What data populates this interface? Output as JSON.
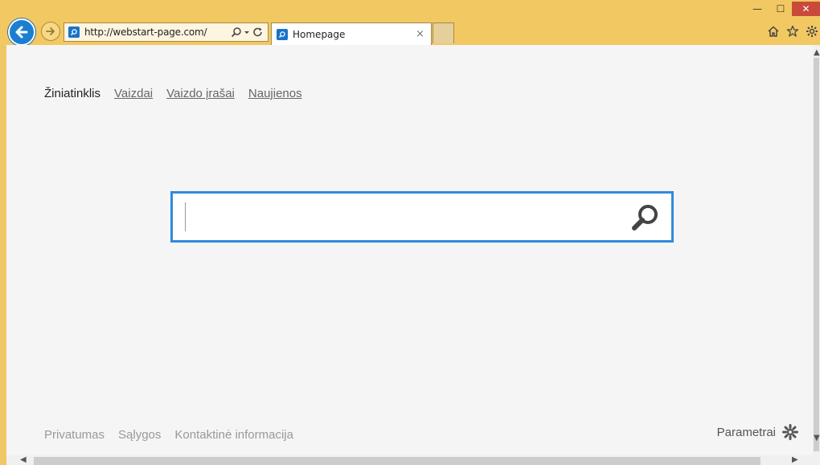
{
  "browser": {
    "url": "http://webstart-page.com/",
    "tab_title": "Homepage",
    "tab_close": "×",
    "window_controls": {
      "minimize": "—",
      "maximize": "☐",
      "close": "✕"
    },
    "icons": [
      "back-arrow-icon",
      "forward-arrow-icon",
      "search-icon",
      "dropdown-icon",
      "refresh-icon",
      "home-icon",
      "favorites-star-icon",
      "tools-gear-icon"
    ]
  },
  "nav": {
    "items": [
      {
        "label": "Žiniatinklis"
      },
      {
        "label": "Vaizdai"
      },
      {
        "label": "Vaizdo įrašai"
      },
      {
        "label": "Naujienos"
      }
    ]
  },
  "search": {
    "value": "",
    "placeholder": ""
  },
  "footer": {
    "links": [
      {
        "label": "Privatumas"
      },
      {
        "label": "Sąlygos"
      },
      {
        "label": "Kontaktinė informacija"
      }
    ],
    "settings_label": "Parametrai"
  },
  "colors": {
    "chrome": "#f2c862",
    "accent": "#2e8bde",
    "back_button": "#1a7fd0"
  }
}
